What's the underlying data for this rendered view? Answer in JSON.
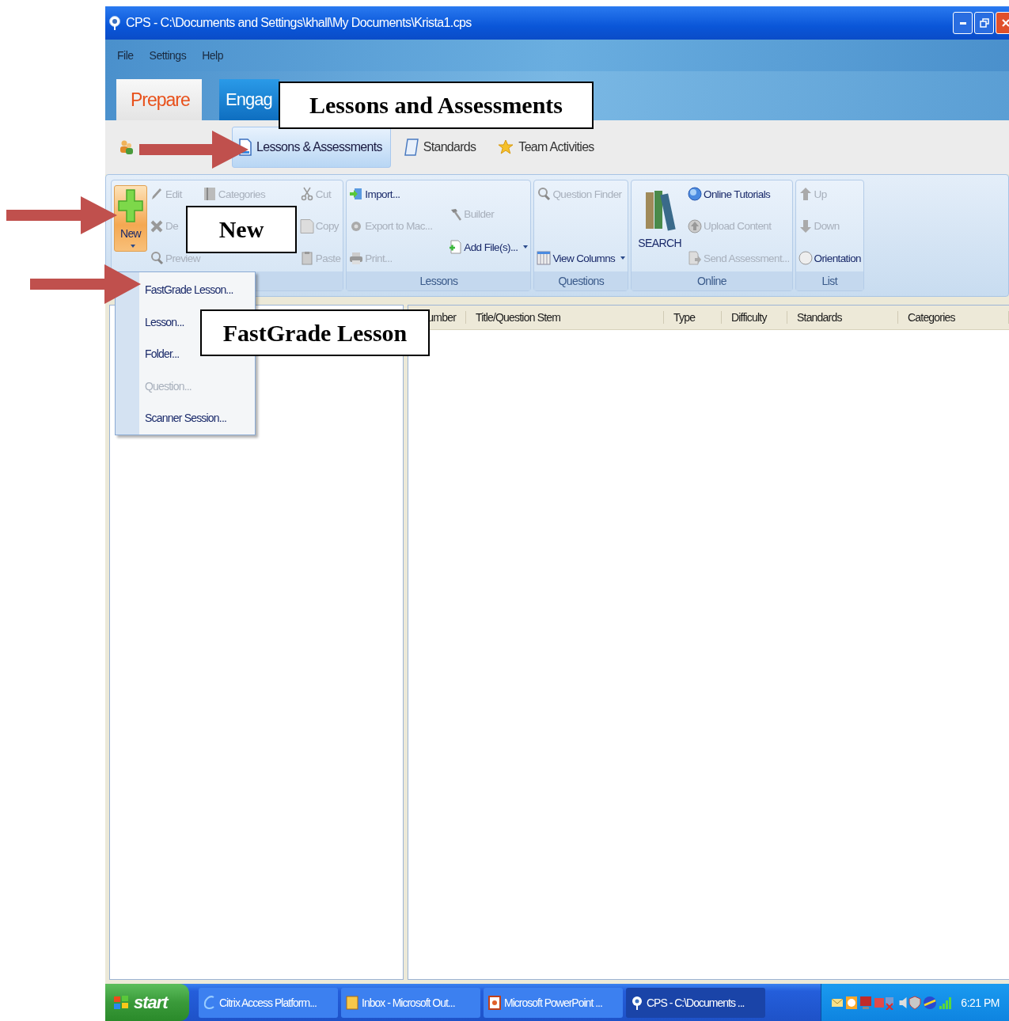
{
  "window": {
    "title": "CPS - C:\\Documents and Settings\\khall\\My Documents\\Krista1.cps"
  },
  "menu": [
    "File",
    "Settings",
    "Help"
  ],
  "tabs": [
    {
      "label": "Prepare",
      "selected": true
    },
    {
      "label": "Engag",
      "selected": false
    }
  ],
  "subtabs": [
    {
      "label": "Lessons & Assessments",
      "selected": true
    },
    {
      "label": "Standards",
      "selected": false
    },
    {
      "label": "Team Activities",
      "selected": false
    }
  ],
  "ribbon": {
    "groups": [
      {
        "columns": [
          [
            {
              "label": "New",
              "kind": "large",
              "disabled": false,
              "dropdown": true,
              "pressed": true
            }
          ],
          [
            {
              "label": "Edit",
              "kind": "small",
              "disabled": true
            },
            {
              "label": "De",
              "kind": "small",
              "disabled": true
            },
            {
              "label": "Preview",
              "kind": "small",
              "disabled": true
            }
          ],
          [
            {
              "label": "Categories",
              "kind": "small",
              "disabled": true
            }
          ],
          [
            {
              "label": "Cut",
              "kind": "small",
              "disabled": true
            },
            {
              "label": "Copy",
              "kind": "small",
              "disabled": true
            },
            {
              "label": "Paste",
              "kind": "small",
              "disabled": true
            }
          ]
        ]
      },
      {
        "label": "Lessons",
        "columns": [
          [
            {
              "label": "Import...",
              "kind": "small",
              "disabled": false
            },
            {
              "label": "Export to Mac...",
              "kind": "small",
              "disabled": true
            },
            {
              "label": "Print...",
              "kind": "small",
              "disabled": true
            }
          ],
          [
            {
              "label": "Builder",
              "kind": "small",
              "disabled": true
            },
            {
              "label": "Add File(s)...",
              "kind": "small",
              "disabled": false,
              "dropdown": true
            }
          ]
        ]
      },
      {
        "label": "Questions",
        "columns": [
          [
            {
              "label": "Question Finder",
              "kind": "small",
              "disabled": true
            },
            {
              "label": "View Columns",
              "kind": "small",
              "disabled": false,
              "dropdown": true
            }
          ]
        ]
      },
      {
        "label": "Online",
        "columns": [
          [
            {
              "label": "SEARCH",
              "kind": "large",
              "disabled": false
            }
          ],
          [
            {
              "label": "Online Tutorials",
              "kind": "small",
              "disabled": false
            },
            {
              "label": "Upload Content",
              "kind": "small",
              "disabled": true
            },
            {
              "label": "Send Assessment...",
              "kind": "small",
              "disabled": true
            }
          ]
        ]
      },
      {
        "label": "List",
        "columns": [
          [
            {
              "label": "Up",
              "kind": "small",
              "disabled": true
            },
            {
              "label": "Down",
              "kind": "small",
              "disabled": true
            },
            {
              "label": "Orientation",
              "kind": "small",
              "disabled": false
            }
          ]
        ]
      }
    ]
  },
  "new_menu": [
    {
      "label": "FastGrade Lesson...",
      "disabled": false
    },
    {
      "label": "Lesson...",
      "disabled": false
    },
    {
      "label": "Folder...",
      "disabled": false
    },
    {
      "label": "Question...",
      "disabled": true
    },
    {
      "label": "Scanner Session...",
      "disabled": false
    }
  ],
  "table": {
    "columns": [
      "umber",
      "Title/Question Stem",
      "Type",
      "Difficulty",
      "Standards",
      "Categories"
    ]
  },
  "taskbar": {
    "start": "start",
    "items": [
      {
        "label": "Citrix Access Platform...",
        "selected": false
      },
      {
        "label": "Inbox - Microsoft Out...",
        "selected": false
      },
      {
        "label": "Microsoft PowerPoint ...",
        "selected": false
      },
      {
        "label": "CPS - C:\\Documents ...",
        "selected": true
      }
    ],
    "clock": "6:21 PM"
  },
  "callouts": [
    {
      "text": "Lessons and Assessments"
    },
    {
      "text": "New"
    },
    {
      "text": "FastGrade Lesson"
    }
  ]
}
